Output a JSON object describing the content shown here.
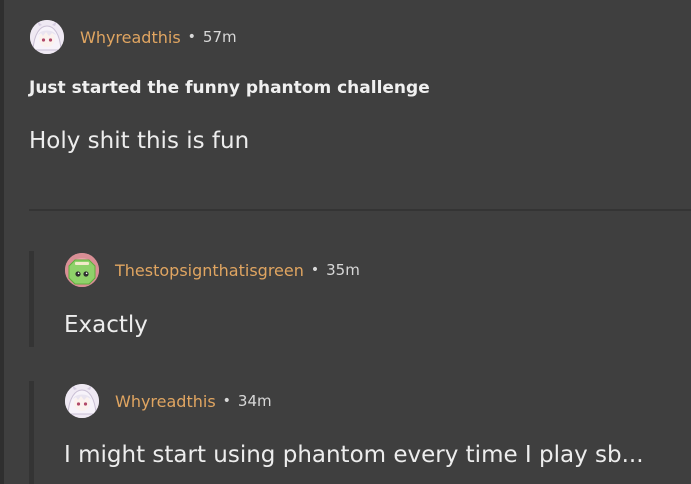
{
  "post": {
    "author": "Whyreadthis",
    "separator": "•",
    "time": "57m",
    "title": "Just started the funny phantom challenge",
    "body": "Holy shit this is fun"
  },
  "replies": [
    {
      "author": "Thestopsignthatisgreen",
      "separator": "•",
      "time": "35m",
      "body": "Exactly",
      "avatar_icon": "green-stop-sign-avatar"
    },
    {
      "author": "Whyreadthis",
      "separator": "•",
      "time": "34m",
      "body": "I might start using phantom every time I play sb...",
      "avatar_icon": "anime-girl-avatar"
    }
  ],
  "colors": {
    "background": "#3f3f3f",
    "username": "#e0a561",
    "text": "#ededed",
    "thread_line": "#343434"
  }
}
